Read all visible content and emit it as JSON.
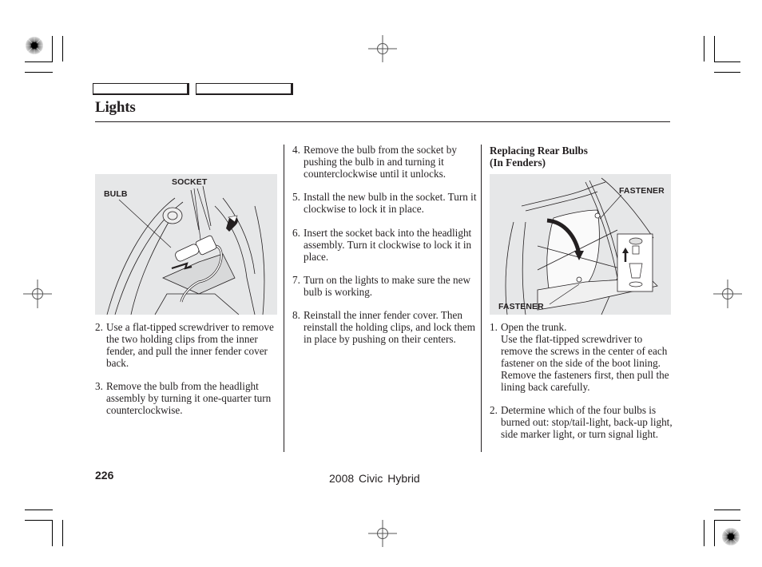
{
  "page": {
    "section_title": "Lights",
    "page_number": "226",
    "footer_text": "2008  Civic  Hybrid",
    "nav_tabs": [
      {
        "label": ""
      },
      {
        "label": ""
      }
    ]
  },
  "left_column": {
    "figure": {
      "labels": {
        "socket": "SOCKET",
        "bulb": "BULB"
      },
      "icon": "headlight-socket-illustration"
    },
    "steps": [
      {
        "number": "2.",
        "text": "Use a flat-tipped screwdriver to remove the two holding clips from the inner fender, and pull the inner fender cover back."
      },
      {
        "number": "3.",
        "text": "Remove the bulb from the headlight assembly by turning it one-quarter turn counterclockwise."
      }
    ]
  },
  "middle_column": {
    "steps": [
      {
        "number": "4.",
        "text": "Remove the bulb from the socket by pushing the bulb in and turning it counterclockwise until it unlocks."
      },
      {
        "number": "5.",
        "text": "Install the new bulb in the socket. Turn it clockwise to lock it in place."
      },
      {
        "number": "6.",
        "text": "Insert the socket back into the headlight assembly. Turn it clockwise to lock it in place."
      },
      {
        "number": "7.",
        "text": "Turn on the lights to make sure the new bulb is working."
      },
      {
        "number": "8.",
        "text": "Reinstall the inner fender cover. Then reinstall the holding clips, and lock them in place by pushing on their centers."
      }
    ]
  },
  "right_column": {
    "heading_line1": "Replacing Rear Bulbs",
    "heading_line2": "(In Fenders)",
    "figure": {
      "labels": {
        "fastener_top": "FASTENER",
        "fastener_bottom": "FASTENER"
      },
      "icon": "trunk-lining-fastener-illustration"
    },
    "steps": [
      {
        "number": "1.",
        "text": "Open the trunk.\nUse the flat-tipped screwdriver to remove the screws in the center of each fastener on the side of the boot lining. Remove the fasteners first, then pull the lining back carefully."
      },
      {
        "number": "2.",
        "text": "Determine which of the four bulbs is burned out: stop/tail-light, back-up light, side marker light, or turn signal light."
      }
    ]
  }
}
